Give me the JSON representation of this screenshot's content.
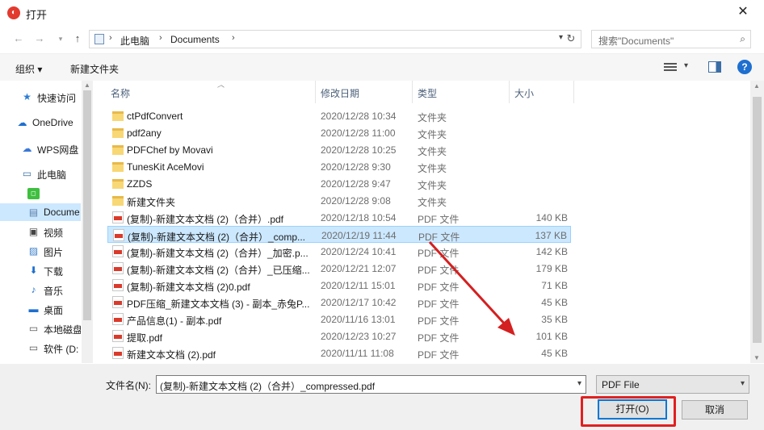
{
  "window": {
    "title": "打开",
    "close_glyph": "✕"
  },
  "address": {
    "crumbs": [
      "此电脑",
      "Documents"
    ],
    "search_placeholder": "搜索\"Documents\""
  },
  "toolbar": {
    "organize": "组织 ▾",
    "new_folder": "新建文件夹"
  },
  "sidebar": {
    "items": [
      {
        "label": "快速访问",
        "icon": "star-icon"
      },
      {
        "label": "OneDrive",
        "icon": "cloud-icon"
      },
      {
        "label": "WPS网盘",
        "icon": "wps-cloud-icon"
      },
      {
        "label": "此电脑",
        "icon": "computer-icon"
      },
      {
        "label": "",
        "icon": "green-app-icon"
      },
      {
        "label": "Docume",
        "icon": "document-icon"
      },
      {
        "label": "视频",
        "icon": "video-icon"
      },
      {
        "label": "图片",
        "icon": "picture-icon"
      },
      {
        "label": "下载",
        "icon": "download-icon"
      },
      {
        "label": "音乐",
        "icon": "music-icon"
      },
      {
        "label": "桌面",
        "icon": "desktop-icon"
      },
      {
        "label": "本地磁盘",
        "icon": "drive-icon"
      },
      {
        "label": "软件 (D:",
        "icon": "drive-icon"
      }
    ]
  },
  "columns": {
    "name": "名称",
    "date": "修改日期",
    "type": "类型",
    "size": "大小"
  },
  "files": [
    {
      "name": "ctPdfConvert",
      "date": "2020/12/28 10:34",
      "type": "文件夹",
      "size": "",
      "kind": "folder"
    },
    {
      "name": "pdf2any",
      "date": "2020/12/28 11:00",
      "type": "文件夹",
      "size": "",
      "kind": "folder"
    },
    {
      "name": "PDFChef by Movavi",
      "date": "2020/12/28 10:25",
      "type": "文件夹",
      "size": "",
      "kind": "folder"
    },
    {
      "name": "TunesKit AceMovi",
      "date": "2020/12/28 9:30",
      "type": "文件夹",
      "size": "",
      "kind": "folder"
    },
    {
      "name": "ZZDS",
      "date": "2020/12/28 9:47",
      "type": "文件夹",
      "size": "",
      "kind": "folder"
    },
    {
      "name": "新建文件夹",
      "date": "2020/12/28 9:08",
      "type": "文件夹",
      "size": "",
      "kind": "folder"
    },
    {
      "name": "(复制)-新建文本文档 (2)（合并）.pdf",
      "date": "2020/12/18 10:54",
      "type": "PDF 文件",
      "size": "140 KB",
      "kind": "pdf"
    },
    {
      "name": "(复制)-新建文本文档 (2)（合并）_comp...",
      "date": "2020/12/19 11:44",
      "type": "PDF 文件",
      "size": "137 KB",
      "kind": "pdf",
      "selected": true
    },
    {
      "name": "(复制)-新建文本文档 (2)（合并）_加密.p...",
      "date": "2020/12/24 10:41",
      "type": "PDF 文件",
      "size": "142 KB",
      "kind": "pdf"
    },
    {
      "name": "(复制)-新建文本文档 (2)（合并）_已压缩...",
      "date": "2020/12/21 12:07",
      "type": "PDF 文件",
      "size": "179 KB",
      "kind": "pdf"
    },
    {
      "name": "(复制)-新建文本文档 (2)0.pdf",
      "date": "2020/12/11 15:01",
      "type": "PDF 文件",
      "size": "71 KB",
      "kind": "pdf"
    },
    {
      "name": "PDF压缩_新建文本文档 (3) - 副本_赤兔P...",
      "date": "2020/12/17 10:42",
      "type": "PDF 文件",
      "size": "45 KB",
      "kind": "pdf"
    },
    {
      "name": "产品信息(1) - 副本.pdf",
      "date": "2020/11/16 13:01",
      "type": "PDF 文件",
      "size": "35 KB",
      "kind": "pdf"
    },
    {
      "name": "提取.pdf",
      "date": "2020/12/23 10:27",
      "type": "PDF 文件",
      "size": "101 KB",
      "kind": "pdf"
    },
    {
      "name": "新建文本文档 (2).pdf",
      "date": "2020/11/11 11:08",
      "type": "PDF 文件",
      "size": "45 KB",
      "kind": "pdf"
    }
  ],
  "footer": {
    "filename_label": "文件名(N):",
    "filename_value": "(复制)-新建文本文档 (2)（合并）_compressed.pdf",
    "filetype_value": "PDF File",
    "open_label": "打开(O)",
    "cancel_label": "取消"
  },
  "colors": {
    "selection": "#cce8ff",
    "accent": "#0078d7",
    "annotation": "#e02020"
  }
}
